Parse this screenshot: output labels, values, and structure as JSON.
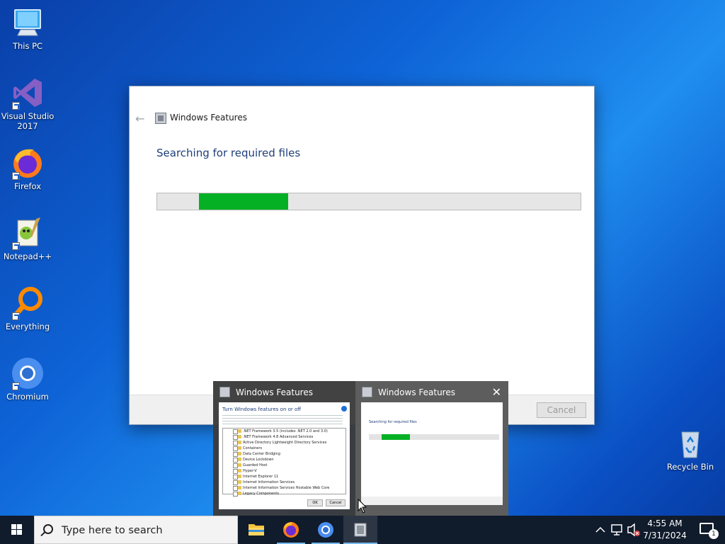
{
  "desktop": {
    "icons": [
      {
        "label": "This PC",
        "icon": "computer-icon"
      },
      {
        "label": "Visual Studio 2017",
        "icon": "visual-studio-icon"
      },
      {
        "label": "Firefox",
        "icon": "firefox-icon"
      },
      {
        "label": "Notepad++",
        "icon": "notepadpp-icon"
      },
      {
        "label": "Everything",
        "icon": "everything-search-icon"
      },
      {
        "label": "Chromium",
        "icon": "chromium-icon"
      },
      {
        "label": "Recycle Bin",
        "icon": "recycle-bin-icon"
      }
    ]
  },
  "dialog": {
    "title": "Windows Features",
    "heading": "Searching for required files",
    "progress_start_fraction": 0.098,
    "progress_end_fraction": 0.31,
    "cancel_label": "Cancel"
  },
  "thumbnails": [
    {
      "title": "Windows Features",
      "content_title": "Turn Windows features on or off",
      "items": [
        ".NET Framework 3.5 (includes .NET 2.0 and 3.0)",
        ".NET Framework 4.8 Advanced Services",
        "Active Directory Lightweight Directory Services",
        "Containers",
        "Data Center Bridging",
        "Device Lockdown",
        "Guarded Host",
        "Hyper-V",
        "Internet Explorer 11",
        "Internet Information Services",
        "Internet Information Services Hostable Web Core",
        "Legacy Components"
      ],
      "ok_label": "OK",
      "cancel_label": "Cancel"
    },
    {
      "title": "Windows Features",
      "content_heading": "Searching for required files"
    }
  ],
  "taskbar": {
    "search_placeholder": "Type here to search",
    "apps": [
      "file-explorer-icon",
      "firefox-icon",
      "chromium-icon",
      "windows-features-icon"
    ],
    "time": "4:55 AM",
    "date": "7/31/2024",
    "notification_count": "1"
  },
  "colors": {
    "progress": "#06b025",
    "heading": "#1e3f7a",
    "taskbar": "#101b2b"
  }
}
